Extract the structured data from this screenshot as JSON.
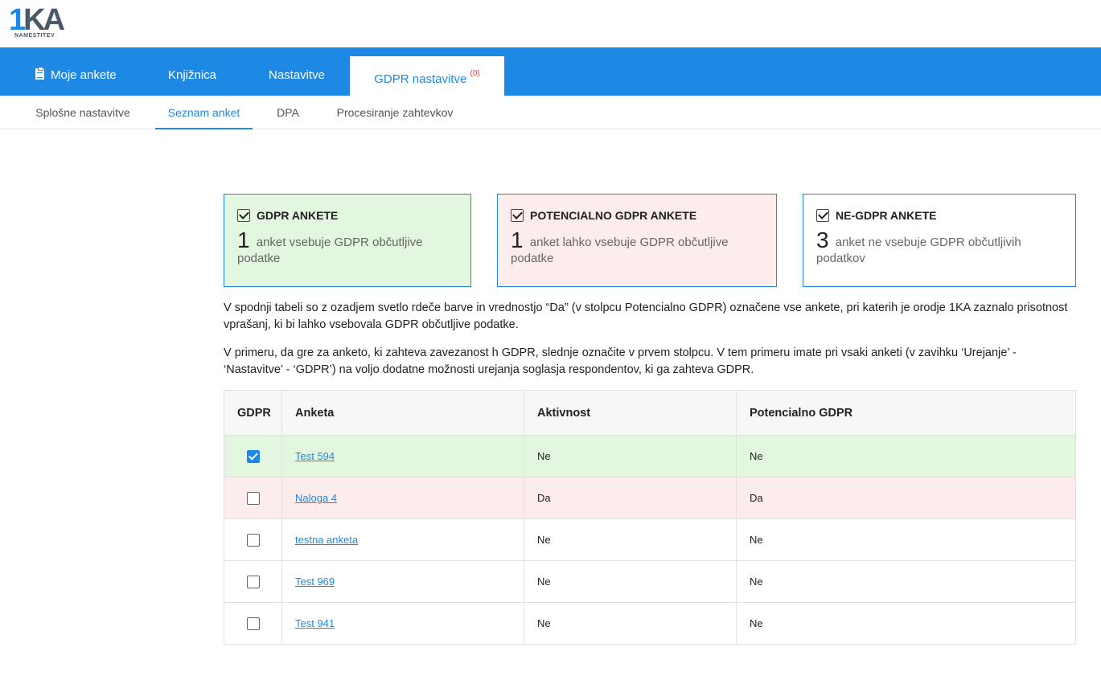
{
  "logo": {
    "main": "1",
    "ka": "KA",
    "sub": "NAMESTITEV"
  },
  "main_nav": {
    "moje_ankete": "Moje ankete",
    "knjiznica": "Knjižnica",
    "nastavitve": "Nastavitve",
    "gdpr_nastavitve": "GDPR nastavitve",
    "gdpr_badge": "(0)"
  },
  "sub_nav": {
    "splosne": "Splošne nastavitve",
    "seznam": "Seznam anket",
    "dpa": "DPA",
    "procesiranje": "Procesiranje zahtevkov"
  },
  "cards": {
    "gdpr": {
      "title": "GDPR ANKETE",
      "count": "1",
      "text": "anket vsebuje GDPR občutljive podatke"
    },
    "potencialno": {
      "title": "POTENCIALNO GDPR ANKETE",
      "count": "1",
      "text": "anket lahko vsebuje GDPR občutljive podatke"
    },
    "negdpr": {
      "title": "NE-GDPR ANKETE",
      "count": "3",
      "text": "anket ne vsebuje GDPR občutljivih podatkov"
    }
  },
  "paragraphs": {
    "p1": "V spodnji tabeli so z ozadjem svetlo rdeče barve in vrednostjo “Da” (v stolpcu Potencialno GDPR) označene vse ankete, pri katerih je orodje 1KA zaznalo prisotnost vprašanj, ki bi lahko vsebovala GDPR občutljive podatke.",
    "p2": "V primeru, da gre za anketo, ki zahteva zavezanost h GDPR, slednje označite v prvem stolpcu. V tem primeru imate pri vsaki anketi (v zavihku ‘Urejanje’ - ‘Nastavitve’ - ‘GDPR’) na voljo dodatne možnosti urejanja soglasja respondentov, ki ga zahteva GDPR."
  },
  "table": {
    "headers": {
      "gdpr": "GDPR",
      "anketa": "Anketa",
      "aktivnost": "Aktivnost",
      "potencialno": "Potencialno GDPR"
    },
    "rows": [
      {
        "gdpr": true,
        "anketa": "Test 594",
        "aktivnost": "Ne",
        "potencialno": "Ne"
      },
      {
        "gdpr": false,
        "anketa": "Naloga 4",
        "aktivnost": "Da",
        "potencialno": "Da"
      },
      {
        "gdpr": false,
        "anketa": "testna anketa",
        "aktivnost": "Ne",
        "potencialno": "Ne"
      },
      {
        "gdpr": false,
        "anketa": "Test 969",
        "aktivnost": "Ne",
        "potencialno": "Ne"
      },
      {
        "gdpr": false,
        "anketa": "Test 941",
        "aktivnost": "Ne",
        "potencialno": "Ne"
      }
    ]
  },
  "colors": {
    "accent": "#1e88e5",
    "green_bg": "#e3f7e0",
    "red_bg": "#fdecec",
    "badge": "#e53935"
  }
}
